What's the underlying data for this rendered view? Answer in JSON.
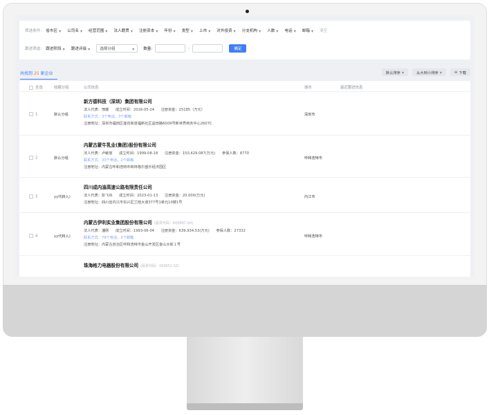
{
  "filters": {
    "row1_label": "筛选条件:",
    "row1_items": [
      "省市区",
      "公司名",
      "经营范围",
      "法人籍贯",
      "注册资本",
      "年份",
      "类型",
      "上市",
      "对外投资",
      "分支机构",
      "人数",
      "电话",
      "邮箱"
    ],
    "clear_label": "清空",
    "row2_label": "跟进筛选:",
    "stage_label": "跟进阶段",
    "eval_label": "跟进评级",
    "group_select": "选择分组",
    "count_label": "数量:",
    "range_dash": "-",
    "confirm_label": "确定"
  },
  "results": {
    "prefix": "共找到",
    "count": "25",
    "suffix": "家企业",
    "sort_default": "默认排序",
    "sort_desc": "从大到小排序",
    "download": "下载"
  },
  "table": {
    "headers": {
      "select_all": "全选",
      "group": "收藏分组",
      "info": "公司信息",
      "city": "城市",
      "followup": "最近跟进信息"
    },
    "rows": [
      {
        "index": "1",
        "group": "默认分组",
        "name": "新方德科技（深圳）集团有限公司",
        "code": "",
        "legal": "法人代表：邢媛",
        "founded": "成立时间：2016-05-24",
        "capital": "注册资金：25185（万元）",
        "staff": "",
        "contact": "联系方式：3个电话，3个邮箱",
        "address": "注册地址：深圳市福田区莲花街道福新社区益田路6009号新世界商务中心2607C",
        "city": "深圳市"
      },
      {
        "index": "2",
        "group": "默认分组",
        "name": "内蒙古蒙牛乳业(集团)股份有限公司",
        "code": "",
        "legal": "法人代表：卢敏放",
        "founded": "成立时间：1999-08-18",
        "capital": "注册资金：150,429.087(万元)",
        "staff": "参保人数：8770",
        "contact": "联系方式：33个电话，2个邮箱",
        "address": "注册地址：内蒙古呼和浩特市和林格尔盛乐经济园区",
        "city": "呼和浩特市"
      },
      {
        "index": "3",
        "group": "yy代转入)",
        "name": "四川成内渝高速公路有限责任公司",
        "code": "",
        "legal": "法人代表：彭飞舟",
        "founded": "成立时间：2023-01-13",
        "capital": "注册资金：20,000(万元)",
        "staff": "",
        "contact": "",
        "address": "注册地址：四川省内江市东兴区兰桂大道377号1单元10楼1号",
        "city": "内江市"
      },
      {
        "index": "4",
        "group": "yy代转入)",
        "name": "内蒙古伊利实业集团股份有限公司",
        "code": "(股票代码：600887.SH)",
        "legal": "法人代表：潘刚",
        "founded": "成立时间：1993-06-04",
        "capital": "注册资金：639,934.53(万元)",
        "staff": "参保人数：27332",
        "contact": "联系方式：79个电话，3个邮箱",
        "address": "注册地址：内蒙古自治区呼和浩特市金山开发区金山大街１号",
        "city": "呼和浩特市"
      },
      {
        "index": "",
        "group": "",
        "name": "珠海格力电器股份有限公司",
        "code": "(股票代码：000651.SZ)",
        "legal": "",
        "founded": "",
        "capital": "",
        "staff": "",
        "contact": "",
        "address": "",
        "city": ""
      }
    ]
  },
  "colors": {
    "accent": "#3f7ef5",
    "count_highlight": "#f07b2a",
    "contact_link": "#7fa6ee"
  },
  "icons": {
    "camera": "camera-dot",
    "download": "download-icon",
    "dropdown": "chevron-down-icon"
  }
}
